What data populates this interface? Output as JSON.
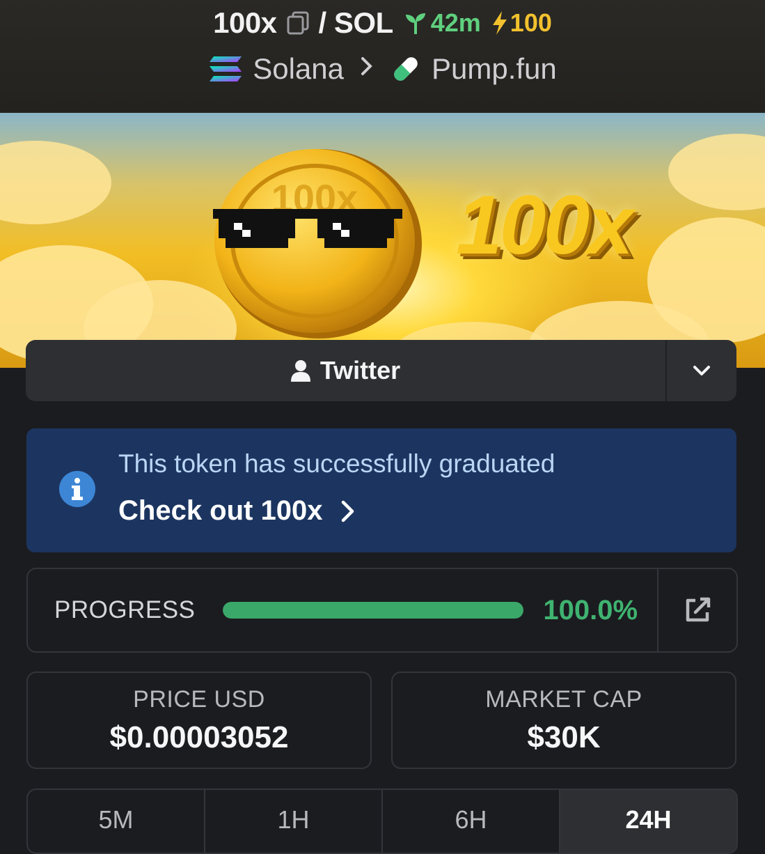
{
  "header": {
    "pair": "100x",
    "quote": "/ SOL",
    "age": "42m",
    "boost": "100",
    "chain": "Solana",
    "dex": "Pump.fun"
  },
  "banner": {
    "text": "100x",
    "coin_text": "100x"
  },
  "twitter": {
    "label": "Twitter"
  },
  "notice": {
    "message": "This token has successfully graduated",
    "link_label": "Check out 100x"
  },
  "progress": {
    "label": "PROGRESS",
    "value_text": "100.0%",
    "fraction": 1.0
  },
  "stats": {
    "price_label": "PRICE USD",
    "price_value": "$0.00003052",
    "mcap_label": "MARKET CAP",
    "mcap_value": "$30K"
  },
  "tabs": [
    {
      "label": "5M"
    },
    {
      "label": "1H"
    },
    {
      "label": "6H"
    },
    {
      "label": "24H"
    }
  ],
  "colors": {
    "accent_green": "#3fb370",
    "boost_yellow": "#f2c12e",
    "notice_bg": "#1c3560"
  }
}
